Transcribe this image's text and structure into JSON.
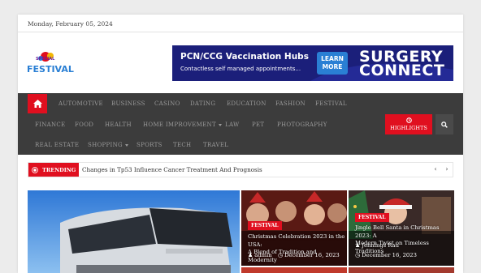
{
  "header": {
    "date": "Monday, February 05, 2024",
    "logo": {
      "top_text": "SPECIAL",
      "main_text": "FESTIVAL"
    }
  },
  "banner": {
    "title": "PCN/CCG Vaccination Hubs",
    "subtitle": "Contactless self managed appointments...",
    "cta": "LEARN MORE",
    "cta_line1": "LEARN",
    "cta_line2": "MORE",
    "brand_line1": "SURGERY",
    "brand_line2": "CONNECT"
  },
  "nav": {
    "row1": [
      "AUTOMOTIVE",
      "BUSINESS",
      "CASINO",
      "DATING",
      "EDUCATION",
      "FASHION",
      "FESTIVAL"
    ],
    "row2": [
      "FINANCE",
      "FOOD",
      "HEALTH",
      "HOME IMPROVEMENT",
      "LAW",
      "PET",
      "PHOTOGRAPHY"
    ],
    "row3": [
      "REAL ESTATE",
      "SHOPPING",
      "SPORTS",
      "TECH",
      "TRAVEL"
    ],
    "highlights": "HIGHLIGHTS"
  },
  "trending": {
    "label": "TRENDING",
    "headline": "Changes in Tp53 Influence Cancer Treatment And Prognosis",
    "prev": "‹",
    "next": "›"
  },
  "cards": [
    {
      "category": "FESTIVAL",
      "title_line1": "Christmas Celebration 2023 in the USA:",
      "title_line2": "A Blend of Tradition and Modernity",
      "author": "admin",
      "date": "December 16, 2023"
    },
    {
      "category": "FESTIVAL",
      "title_line1": "Jingle Bell Santa in Christmas 2023: A",
      "title_line2": "Modern Twist on Timeless Traditions",
      "author": "Jennings Rau",
      "date": "December 16, 2023"
    }
  ],
  "colors": {
    "accent": "#e00f1f",
    "nav_bg": "#3c3c3c",
    "banner_bg": "#1b1f7a"
  }
}
